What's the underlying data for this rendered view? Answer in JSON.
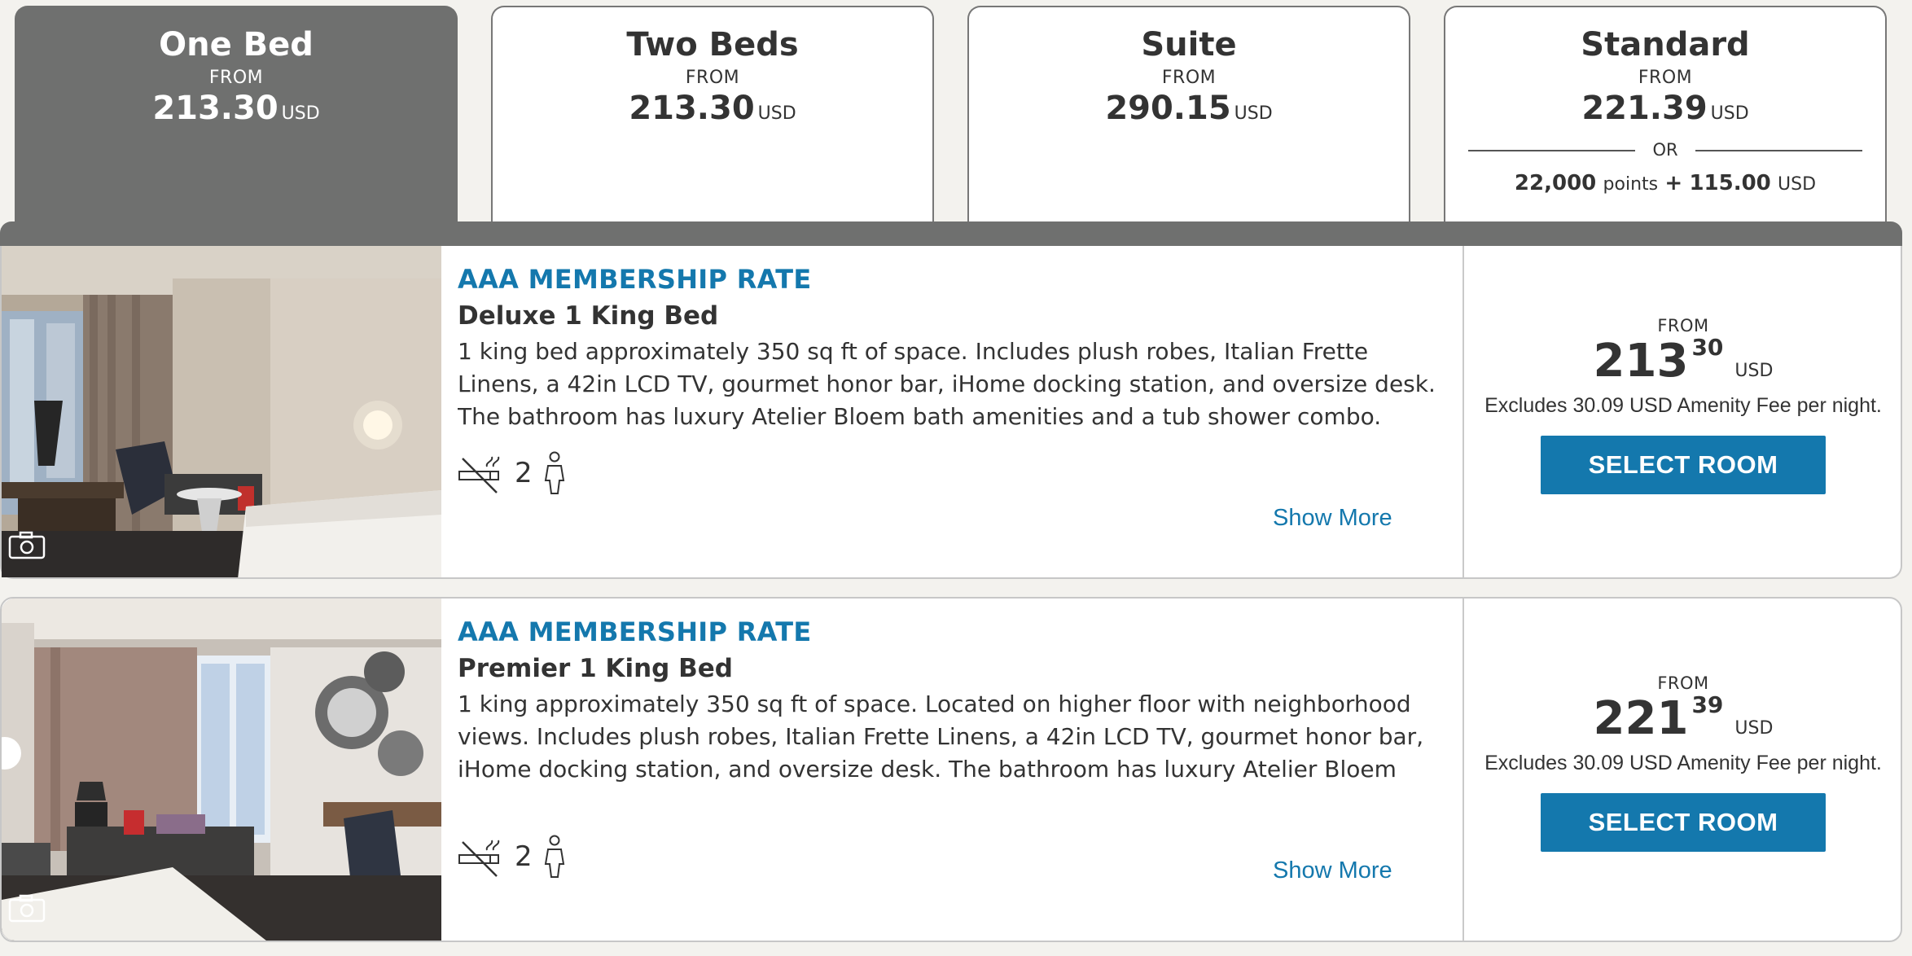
{
  "tabs": [
    {
      "name": "One Bed",
      "from": "FROM",
      "price": "213.30",
      "currency": "USD"
    },
    {
      "name": "Two Beds",
      "from": "FROM",
      "price": "213.30",
      "currency": "USD"
    },
    {
      "name": "Suite",
      "from": "FROM",
      "price": "290.15",
      "currency": "USD"
    },
    {
      "name": "Standard",
      "from": "FROM",
      "price": "221.39",
      "currency": "USD",
      "or": "OR",
      "points": "22,000",
      "points_label": "points",
      "plus": "+",
      "cash": "115.00",
      "cash_currency": "USD"
    }
  ],
  "active_tab": "One Bed",
  "colors": {
    "accent": "#1478ad",
    "tab_active": "#6f706f",
    "page_bg": "#f3f2ee"
  },
  "rooms": [
    {
      "rate": "AAA MEMBERSHIP RATE",
      "name": "Deluxe 1 King Bed",
      "description": "1 king bed approximately 350 sq ft of space. Includes plush robes, Italian Frette Linens, a 42in LCD TV, gourmet honor bar, iHome docking station, and oversize desk. The bathroom has luxury Atelier Bloem bath amenities and a tub shower combo.",
      "guests": "2",
      "icons": [
        "camera-icon",
        "no-smoking-icon",
        "person-icon"
      ],
      "show_more": "Show More",
      "from": "FROM",
      "price_whole": "213",
      "price_cents": "30",
      "currency": "USD",
      "fee_note": "Excludes 30.09 USD Amenity Fee per night.",
      "select_label": "SELECT ROOM"
    },
    {
      "rate": "AAA MEMBERSHIP RATE",
      "name": "Premier 1 King Bed",
      "description": "1 king approximately 350 sq ft of space. Located on higher floor with neighborhood views. Includes plush robes, Italian Frette Linens, a 42in LCD TV, gourmet honor bar, iHome docking station, and oversize desk. The bathroom has luxury Atelier Bloem bath amenities",
      "guests": "2",
      "icons": [
        "camera-icon",
        "no-smoking-icon",
        "person-icon"
      ],
      "show_more": "Show More",
      "from": "FROM",
      "price_whole": "221",
      "price_cents": "39",
      "currency": "USD",
      "fee_note": "Excludes 30.09 USD Amenity Fee per night.",
      "select_label": "SELECT ROOM"
    }
  ]
}
